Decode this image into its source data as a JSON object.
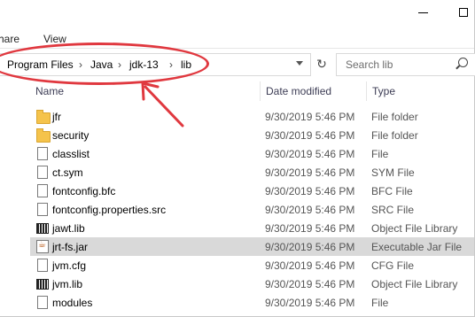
{
  "ribbon": {
    "tabs": [
      "hare",
      "View"
    ]
  },
  "address": {
    "crumbs": [
      "Program Files",
      "Java",
      "jdk-13",
      "lib"
    ],
    "separator": "›"
  },
  "search": {
    "placeholder": "Search lib"
  },
  "columns": {
    "name": "Name",
    "date": "Date modified",
    "type": "Type"
  },
  "files": [
    {
      "name": "jfr",
      "date": "9/30/2019 5:46 PM",
      "type": "File folder",
      "icon": "folder-icon"
    },
    {
      "name": "security",
      "date": "9/30/2019 5:46 PM",
      "type": "File folder",
      "icon": "folder-icon"
    },
    {
      "name": "classlist",
      "date": "9/30/2019 5:46 PM",
      "type": "File",
      "icon": "file-icon"
    },
    {
      "name": "ct.sym",
      "date": "9/30/2019 5:46 PM",
      "type": "SYM File",
      "icon": "file-icon"
    },
    {
      "name": "fontconfig.bfc",
      "date": "9/30/2019 5:46 PM",
      "type": "BFC File",
      "icon": "file-icon"
    },
    {
      "name": "fontconfig.properties.src",
      "date": "9/30/2019 5:46 PM",
      "type": "SRC File",
      "icon": "file-icon"
    },
    {
      "name": "jawt.lib",
      "date": "9/30/2019 5:46 PM",
      "type": "Object File Library",
      "icon": "library-icon"
    },
    {
      "name": "jrt-fs.jar",
      "date": "9/30/2019 5:46 PM",
      "type": "Executable Jar File",
      "icon": "jar-icon",
      "selected": true
    },
    {
      "name": "jvm.cfg",
      "date": "9/30/2019 5:46 PM",
      "type": "CFG File",
      "icon": "file-icon"
    },
    {
      "name": "jvm.lib",
      "date": "9/30/2019 5:46 PM",
      "type": "Object File Library",
      "icon": "library-icon"
    },
    {
      "name": "modules",
      "date": "9/30/2019 5:46 PM",
      "type": "File",
      "icon": "file-icon"
    }
  ],
  "annotation": {
    "color": "#e0383f"
  }
}
